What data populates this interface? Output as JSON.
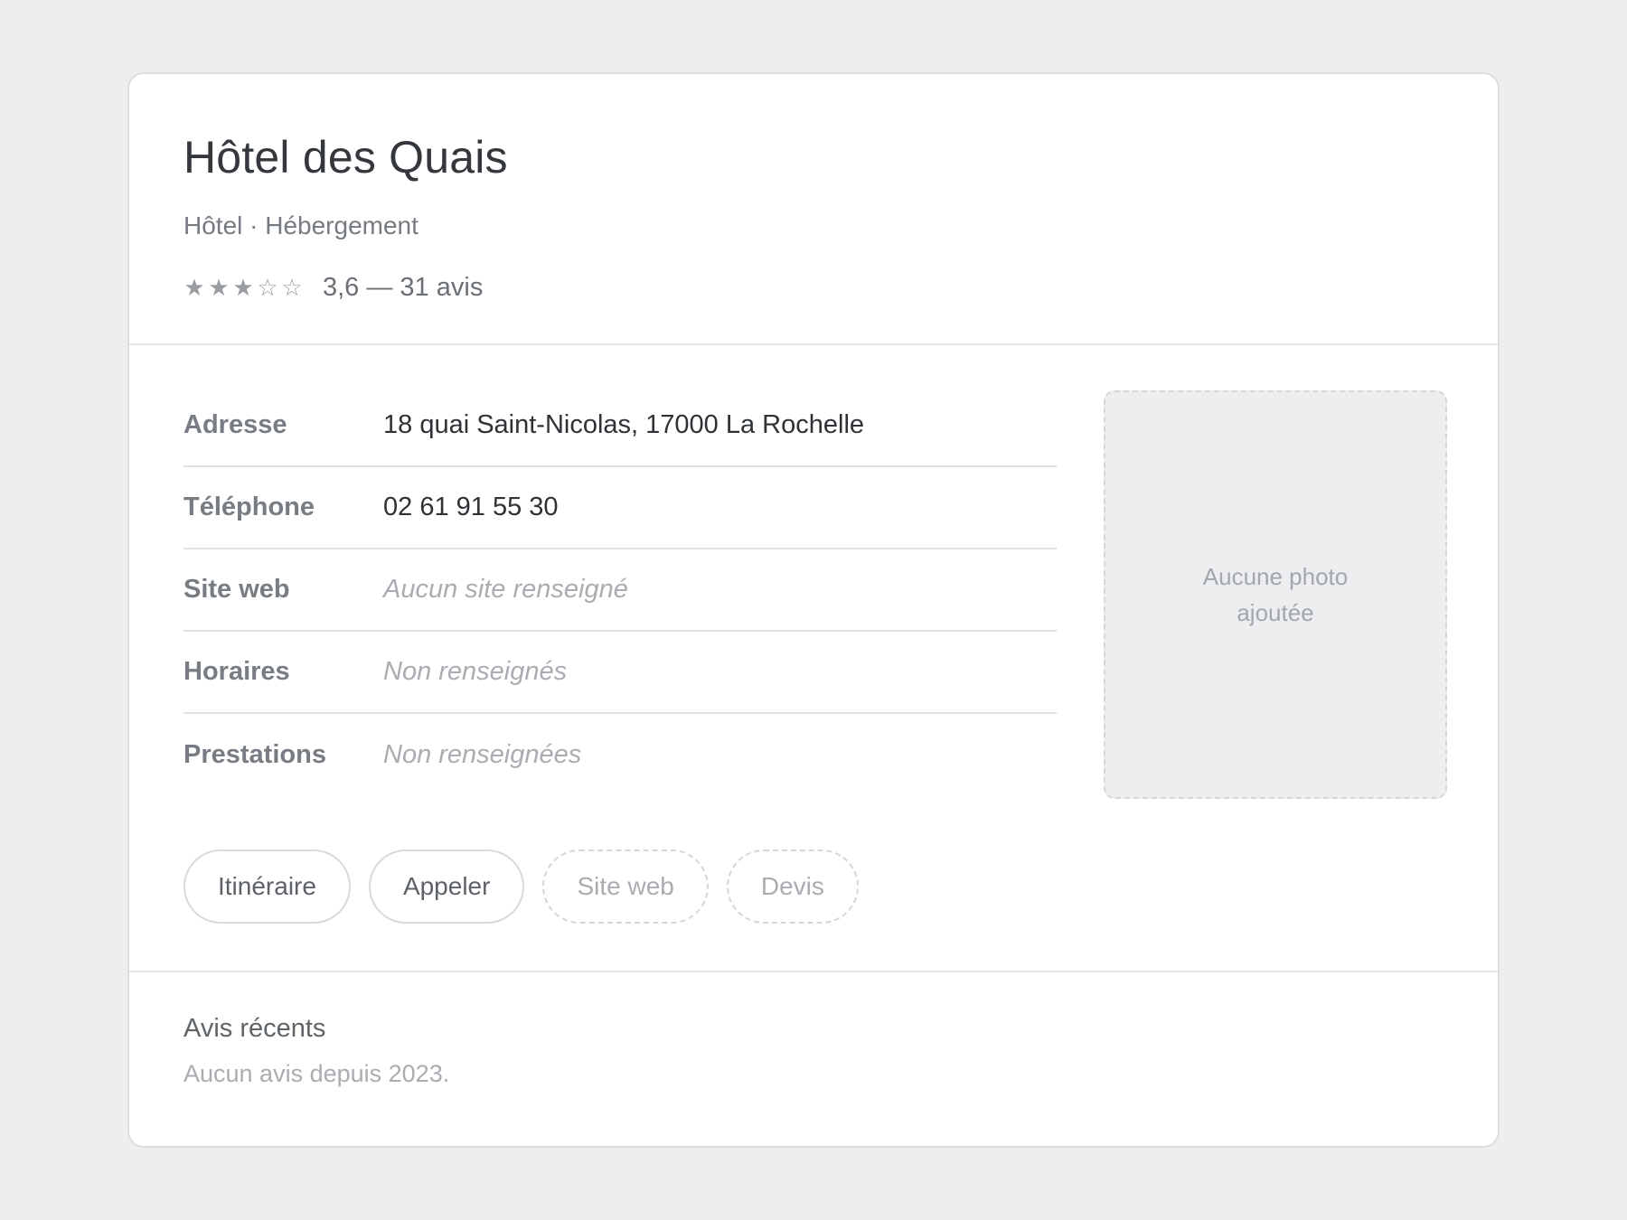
{
  "listing": {
    "title": "Hôtel des Quais",
    "category": "Hôtel · Hébergement",
    "rating": {
      "value": 3.6,
      "max": 5,
      "stars": [
        "★",
        "★",
        "★",
        "☆",
        "☆"
      ],
      "text": "3,6 — 31 avis"
    }
  },
  "details": [
    {
      "label": "Adresse",
      "value": "18 quai Saint-Nicolas, 17000 La Rochelle",
      "empty": false
    },
    {
      "label": "Téléphone",
      "value": "02 61 91 55 30",
      "empty": false
    },
    {
      "label": "Site web",
      "value": "Aucun site renseigné",
      "empty": true
    },
    {
      "label": "Horaires",
      "value": "Non renseignés",
      "empty": true
    },
    {
      "label": "Prestations",
      "value": "Non renseignées",
      "empty": true
    }
  ],
  "photo": {
    "placeholder": "Aucune photo ajoutée"
  },
  "actions": [
    {
      "label": "Itinéraire",
      "enabled": true
    },
    {
      "label": "Appeler",
      "enabled": true
    },
    {
      "label": "Site web",
      "enabled": false
    },
    {
      "label": "Devis",
      "enabled": false
    }
  ],
  "reviews": {
    "title": "Avis récents",
    "empty_text": "Aucun avis depuis 2023."
  },
  "colors": {
    "background": "#edeef0",
    "card": "#ffffff",
    "title": "#34383c",
    "muted": "#a9adb2"
  }
}
